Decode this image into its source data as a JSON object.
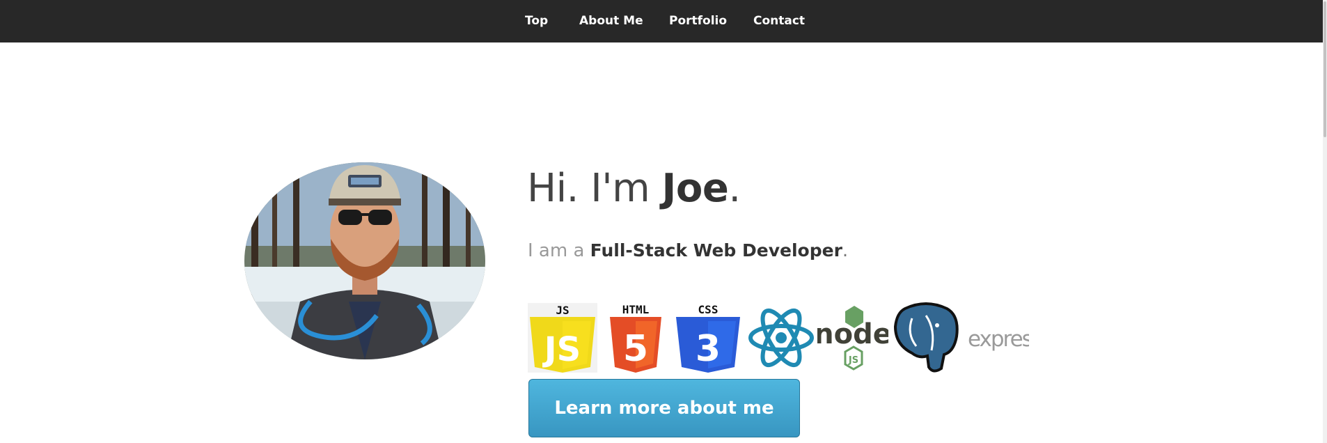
{
  "nav": {
    "items": [
      {
        "label": "Top"
      },
      {
        "label": "About Me"
      },
      {
        "label": "Portfolio"
      },
      {
        "label": "Contact"
      }
    ]
  },
  "hero": {
    "greeting_prefix": "Hi. I'm",
    "greeting_name": "Joe",
    "greeting_suffix": ".",
    "tagline_prefix": "I am a",
    "tagline_role": "Full-Stack Web Developer",
    "tagline_suffix": ".",
    "cta_label": "Learn more about me"
  },
  "tech_icons": [
    {
      "name": "javascript-icon",
      "label": "JS",
      "color": "#f0d91a"
    },
    {
      "name": "html5-icon",
      "label": "HTML",
      "color": "#e44d26"
    },
    {
      "name": "css3-icon",
      "label": "CSS",
      "color": "#2a5bd7"
    },
    {
      "name": "react-icon",
      "color": "#1f8ab3"
    },
    {
      "name": "nodejs-icon",
      "label": "node",
      "sublabel": "JS",
      "color": "#68a063"
    },
    {
      "name": "postgresql-icon",
      "color": "#336791"
    },
    {
      "name": "express-icon",
      "label": "express",
      "color": "#9a9a9a"
    }
  ],
  "colors": {
    "navbar": "#282828",
    "cta_button": "#3a9dca"
  }
}
